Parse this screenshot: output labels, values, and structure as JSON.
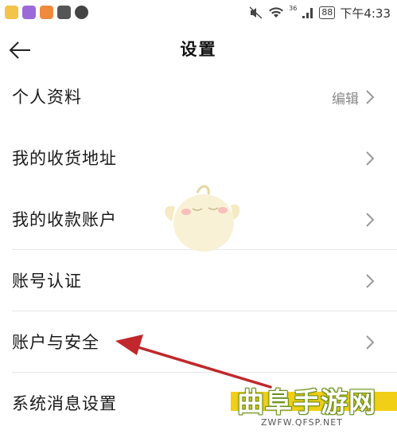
{
  "status_bar": {
    "network_label": "36",
    "battery": "88",
    "time": "下午4:33"
  },
  "header": {
    "title": "设置"
  },
  "rows": [
    {
      "label": "个人资料",
      "value": "编辑"
    },
    {
      "label": "我的收货地址"
    },
    {
      "label": "我的收款账户"
    },
    {
      "label": "账号认证"
    },
    {
      "label": "账户与安全"
    },
    {
      "label": "系统消息设置"
    }
  ],
  "watermark": {
    "title": "曲阜手游网",
    "url": "ZWFW.QFSP.NET"
  },
  "colors": {
    "arrow": "#c0282d",
    "watermark_bar": "#f2cf17"
  }
}
